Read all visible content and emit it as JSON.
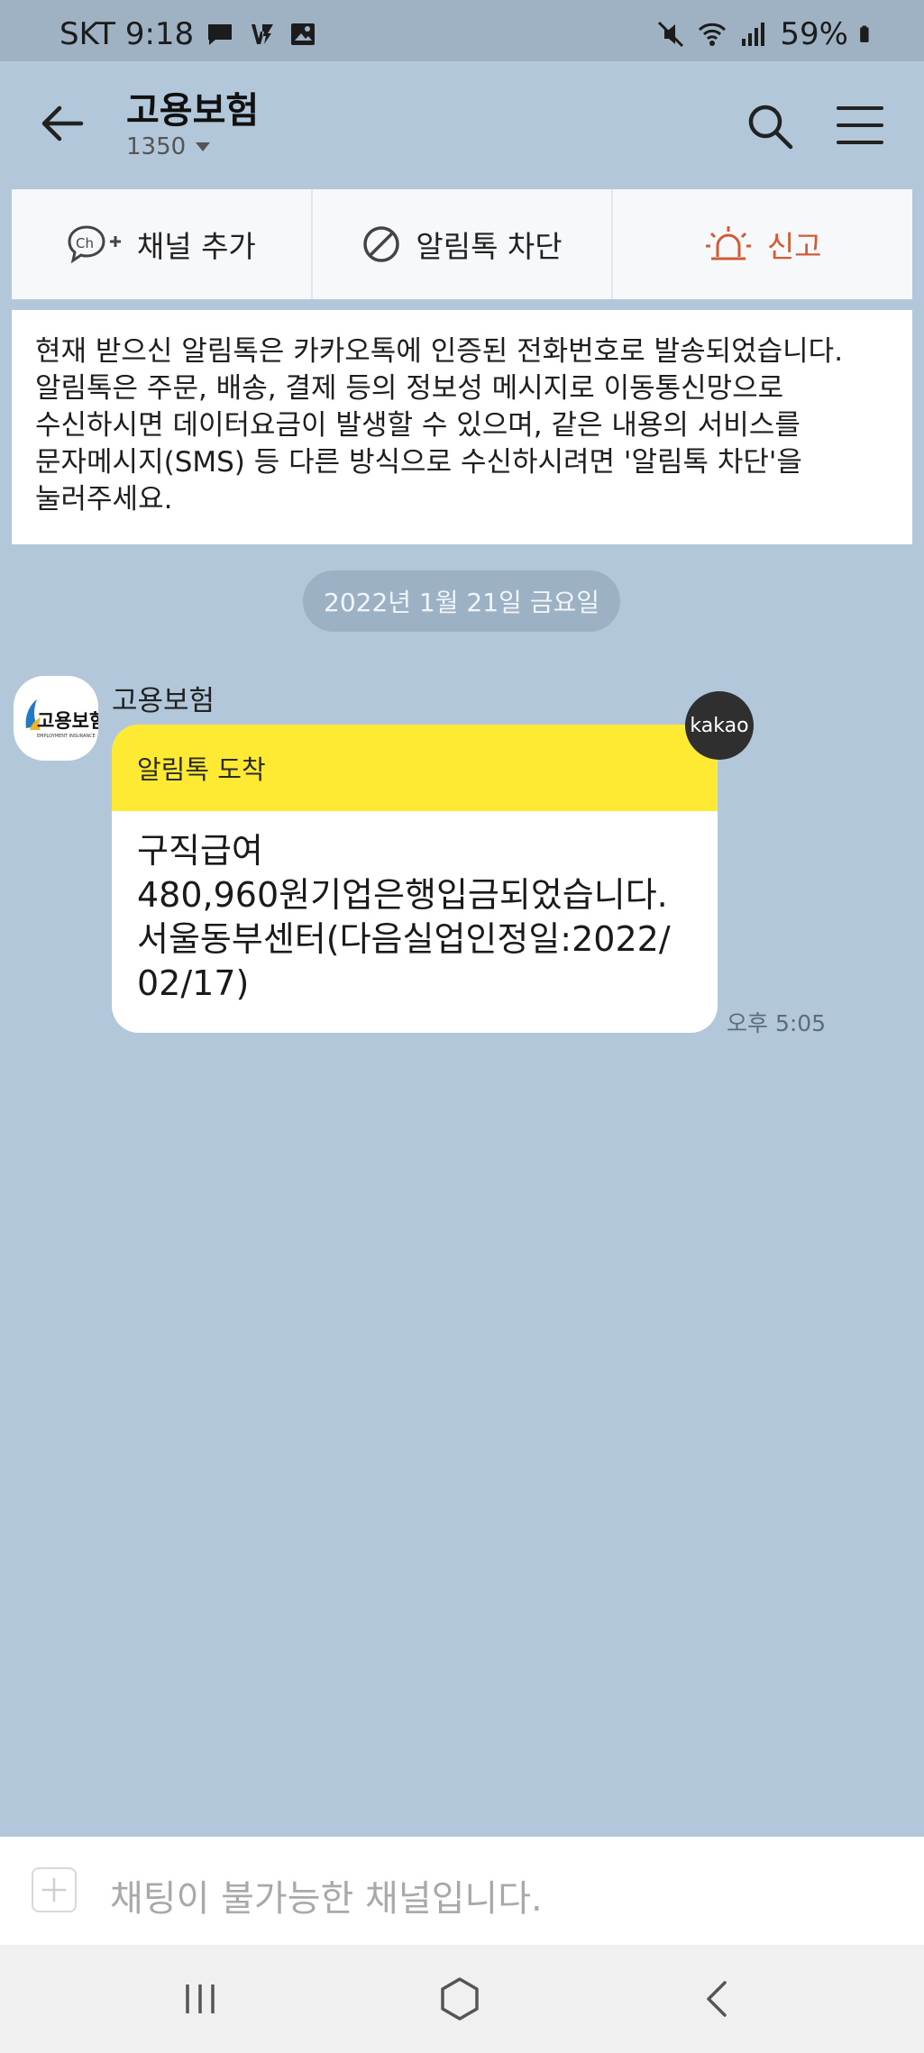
{
  "status_bar": {
    "carrier_time": "SKT 9:18",
    "battery": "59%",
    "icons": [
      "message-icon",
      "kakao-v3-icon",
      "gallery-icon",
      "mute-icon",
      "wifi-icon",
      "signal-icon",
      "battery-icon"
    ]
  },
  "header": {
    "title": "고용보험",
    "subtitle": "1350"
  },
  "actions": {
    "add_channel": "채널 추가",
    "block": "알림톡 차단",
    "report": "신고",
    "report_color": "#d25b35"
  },
  "notice": {
    "text": "현재 받으신 알림톡은 카카오톡에 인증된 전화번호로 발송되었습니다. 알림톡은 주문, 배송, 결제 등의 정보성 메시지로 이동통신망으로 수신하시면 데이터요금이 발생할 수 있으며, 같은 내용의 서비스를 문자메시지(SMS) 등 다른 방식으로 수신하시려면 '알림톡 차단'을 눌러주세요."
  },
  "date_divider": "2022년 1월 21일 금요일",
  "message": {
    "sender": "고용보험",
    "avatar_text": "고용보험",
    "avatar_subtext": "EMPLOYMENT INSURANCE",
    "header": "알림톡 도착",
    "body": "구직급여\n480,960원기업은행입금되었습니다.\n서울동부센터(다음실업인정일:2022/\n02/17)",
    "badge": "kakao",
    "time": "오후 5:05",
    "header_color": "#fee933"
  },
  "input": {
    "placeholder": "채팅이 불가능한 채널입니다."
  },
  "nav": {
    "items": [
      "recent-apps-icon",
      "home-icon",
      "back-icon"
    ]
  }
}
